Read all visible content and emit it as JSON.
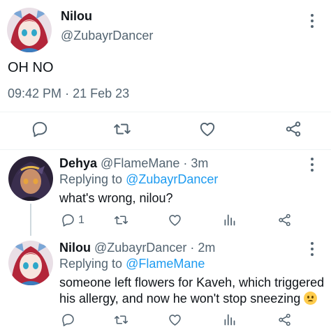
{
  "main_tweet": {
    "author_name": "Nilou",
    "author_handle": "@ZubayrDancer",
    "text": "OH NO",
    "time": "09:42 PM",
    "separator": "·",
    "date": "21 Feb 23"
  },
  "replies": [
    {
      "author_name": "Dehya",
      "author_handle": "@FlameMane",
      "separator": "·",
      "age": "3m",
      "replying_prefix": "Replying to",
      "replying_handle": "@ZubayrDancer",
      "text": "what's wrong, nilou?",
      "reply_count": "1"
    },
    {
      "author_name": "Nilou",
      "author_handle": "@ZubayrDancer",
      "separator": "·",
      "age": "2m",
      "replying_prefix": "Replying to",
      "replying_handle": "@FlameMane",
      "text_line1": "someone left flowers for Kaveh, which triggered",
      "text_line2": "his allergy, and now he won't stop sneezing"
    }
  ],
  "icons": [
    "reply-icon",
    "retweet-icon",
    "like-icon",
    "share-icon",
    "views-icon",
    "more-icon",
    "sad-face-emoji"
  ],
  "colors": {
    "text": "#0f1419",
    "muted": "#536471",
    "link": "#1d9bf0",
    "divider": "#eff3f4",
    "thread_line": "#cfd9de"
  }
}
